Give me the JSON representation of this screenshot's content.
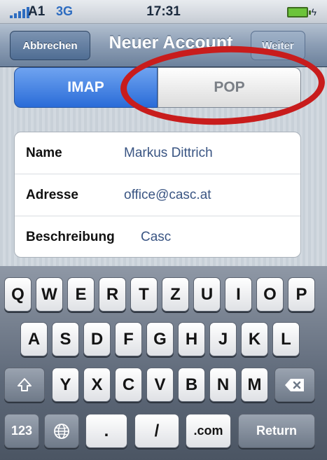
{
  "status_bar": {
    "carrier": "A1",
    "network": "3G",
    "time": "17:31"
  },
  "nav": {
    "cancel_label": "Abbrechen",
    "title": "Neuer Account",
    "next_label": "Weiter"
  },
  "segments": {
    "imap": "IMAP",
    "pop": "POP",
    "selected": "IMAP"
  },
  "form": {
    "rows": [
      {
        "label": "Name",
        "value": "Markus Dittrich"
      },
      {
        "label": "Adresse",
        "value": "office@casc.at"
      },
      {
        "label": "Beschreibung",
        "value": "Casc"
      }
    ]
  },
  "keyboard": {
    "row1": [
      "Q",
      "W",
      "E",
      "R",
      "T",
      "Z",
      "U",
      "I",
      "O",
      "P"
    ],
    "row2": [
      "A",
      "S",
      "D",
      "F",
      "G",
      "H",
      "J",
      "K",
      "L"
    ],
    "row3": [
      "Y",
      "X",
      "C",
      "V",
      "B",
      "N",
      "M"
    ],
    "numbers_label": "123",
    "dot_label": ".",
    "slash_label": "/",
    "com_label": ".com",
    "return_label": "Return"
  },
  "colors": {
    "accent_blue": "#2a6cd8",
    "annotation_red": "#c81c1c"
  }
}
